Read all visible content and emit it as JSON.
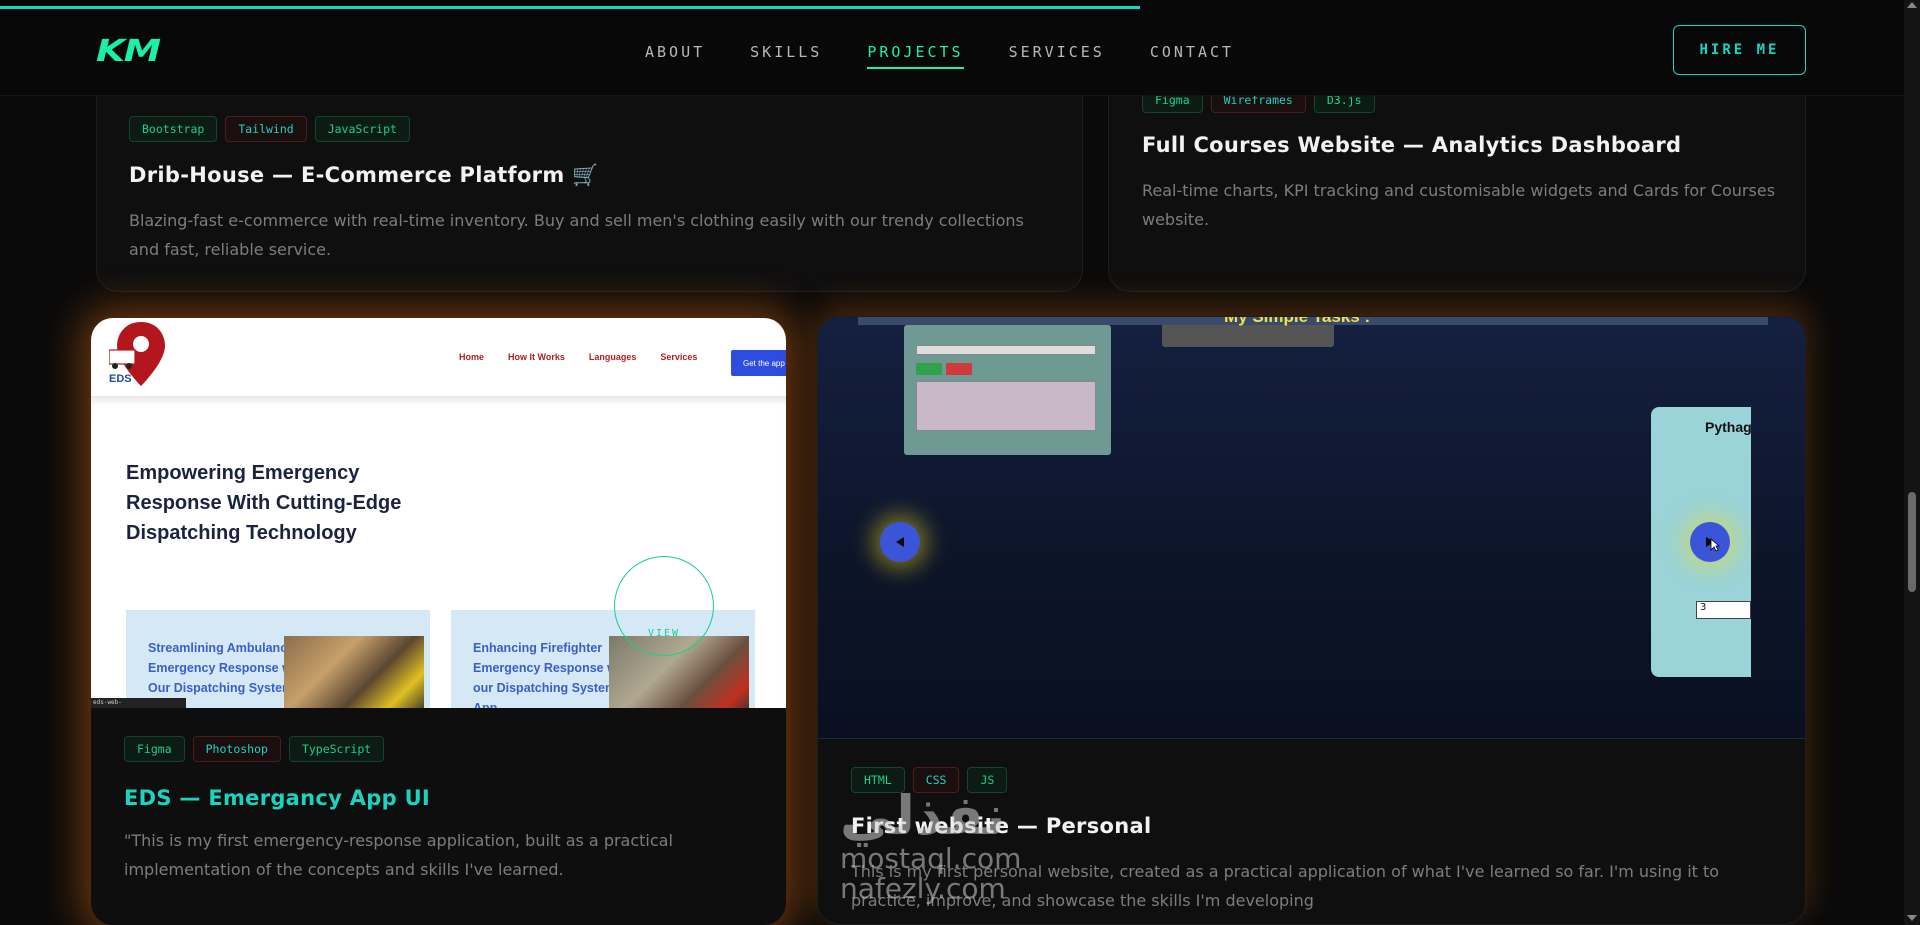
{
  "header": {
    "logo": "KM",
    "nav": [
      "ABOUT",
      "SKILLS",
      "PROJECTS",
      "SERVICES",
      "CONTACT"
    ],
    "active_nav": "PROJECTS",
    "hire_label": "HIRE ME"
  },
  "scroll_progress": 0.594,
  "colors": {
    "accent": "#19f0a8",
    "accent_cyan": "#19d4c1",
    "glow": "#e66e14"
  },
  "projects": [
    {
      "tags": [
        "Bootstrap",
        "Tailwind",
        "JavaScript"
      ],
      "title": "Drib-House — E-Commerce Platform 🛒",
      "description": "Blazing-fast e-commerce with real-time inventory. Buy and sell men's clothing easily with our trendy collections and fast, reliable service."
    },
    {
      "tags": [
        "Figma",
        "Wireframes",
        "D3.js"
      ],
      "title": "Full Courses Website — Analytics Dashboard",
      "description": "Real-time charts, KPI tracking and customisable widgets and Cards for Courses website."
    },
    {
      "tags": [
        "Figma",
        "Photoshop",
        "TypeScript"
      ],
      "title": "EDS — Emergancy App UI",
      "description": "\"This is my first emergency-response application, built as a practical implementation of the concepts and skills I've learned.",
      "preview": {
        "logo_text": "EDS",
        "nav": [
          "Home",
          "How It Works",
          "Languages",
          "Services"
        ],
        "cta": "Get the app",
        "hero": "Empowering Emergency Response With Cutting-Edge Dispatching Technology",
        "box1": "Streamlining Ambulance Emergency Response with Our Dispatching System App",
        "box2": "Enhancing Firefighter Emergency Response with our Dispatching System App",
        "status_url": "eds-web-eds.web.app/index.html",
        "view_label": "VIEW"
      }
    },
    {
      "tags": [
        "HTML",
        "CSS",
        "JS"
      ],
      "title": "First website — Personal",
      "description": "This is my first personal website, created as a practical application of what I've learned so far. I'm using it to practice, improve, and showcase the skills I'm developing",
      "preview": {
        "tasks_title": "My Simple Tasks :",
        "panel_title": "Pythag",
        "input_value": "3"
      }
    }
  ],
  "watermark": {
    "main": "نفذلي",
    "line1": "mostaql.com",
    "line2": "nafezly.com"
  }
}
